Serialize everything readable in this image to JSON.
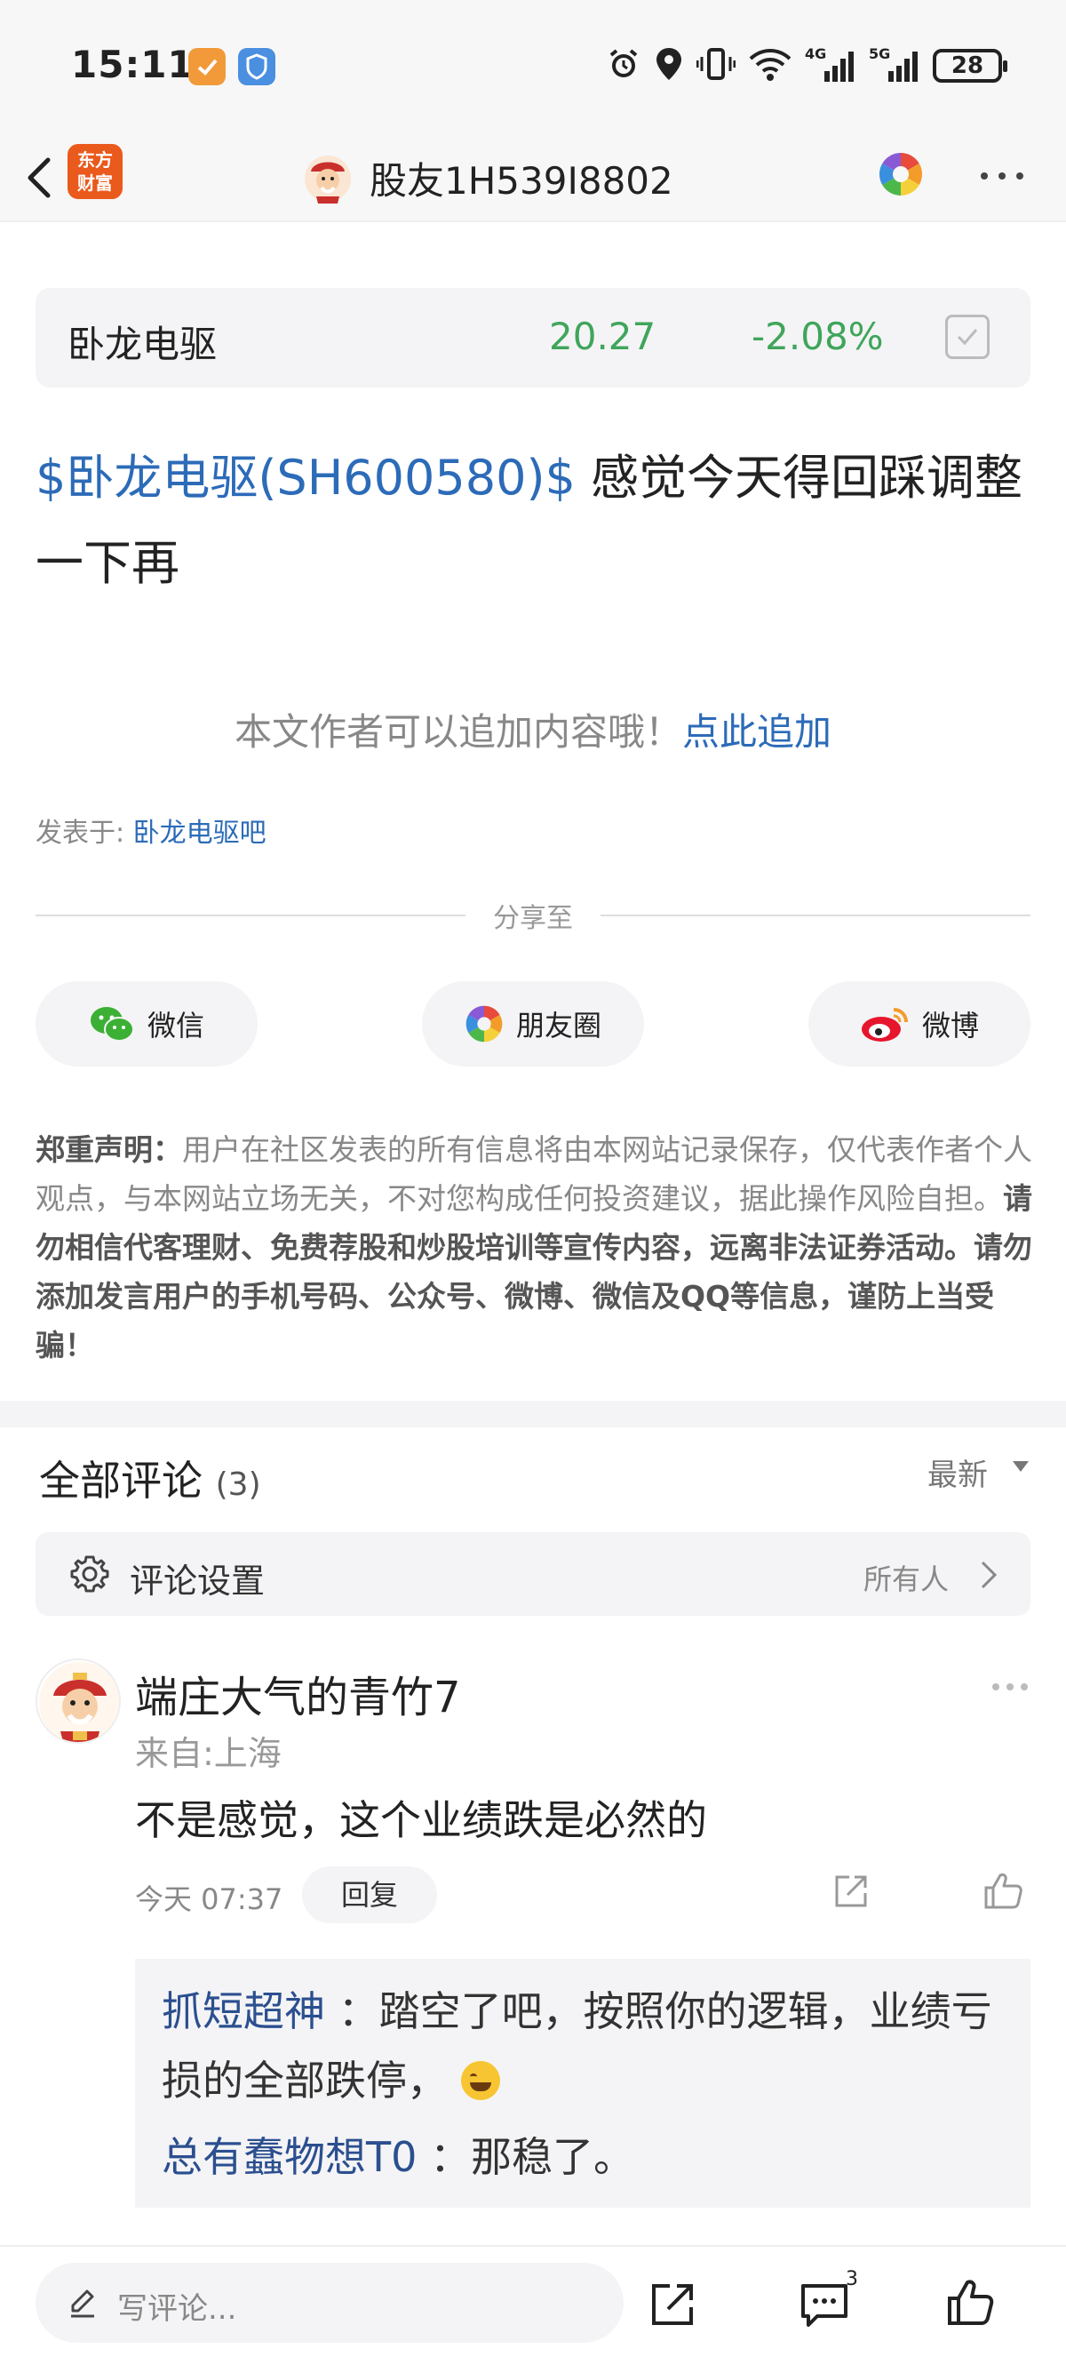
{
  "status_bar": {
    "time": "15:11",
    "battery": "28",
    "network_labels": [
      "4G",
      "5G"
    ]
  },
  "nav": {
    "logo_text": [
      "东方",
      "财富"
    ],
    "title": "股友1H539I8802"
  },
  "stock": {
    "name": "卧龙电驱",
    "price": "20.27",
    "change": "-2.08%"
  },
  "post": {
    "tag": "$卧龙电驱(SH600580)$",
    "text_line1": " 感觉今天得回踩调整",
    "text_line2": "一下再"
  },
  "append": {
    "prompt": "本文作者可以追加内容哦！",
    "link": "点此追加"
  },
  "posted_in": {
    "label": "发表于: ",
    "bar": "卧龙电驱吧"
  },
  "share": {
    "title": "分享至",
    "buttons": [
      "微信",
      "朋友圈",
      "微博"
    ]
  },
  "disclaimer": {
    "heading": "郑重声明：",
    "normal": "用户在社区发表的所有信息将由本网站记录保存，仅代表作者个人观点，与本网站立场无关，不对您构成任何投资建议，据此操作风险自担。",
    "bold": "请勿相信代客理财、免费荐股和炒股培训等宣传内容，远离非法证券活动。请勿添加发言用户的手机号码、公众号、微博、微信及QQ等信息，谨防上当受骗！"
  },
  "comments": {
    "title": "全部评论",
    "count": "(3)",
    "sort": "最新",
    "settings_label": "评论设置",
    "settings_value": "所有人",
    "items": [
      {
        "author": "端庄大气的青竹7",
        "from": "来自:上海",
        "text": "不是感觉，这个业绩跌是必然的",
        "time": "今天 07:37",
        "reply_label": "回复",
        "replies": [
          {
            "name": "抓短超神",
            "text": "：踏空了吧，按照你的逻辑，业绩亏损的全部跌停，"
          },
          {
            "name": "总有蠢物想T0",
            "text": "：那稳了。"
          }
        ]
      }
    ]
  },
  "bottom_bar": {
    "placeholder": "写评论...",
    "comment_badge": "3"
  },
  "colors": {
    "link_blue": "#2c6bb8",
    "down_green": "#3fa55b",
    "brand_orange": "#ea5a1c"
  }
}
